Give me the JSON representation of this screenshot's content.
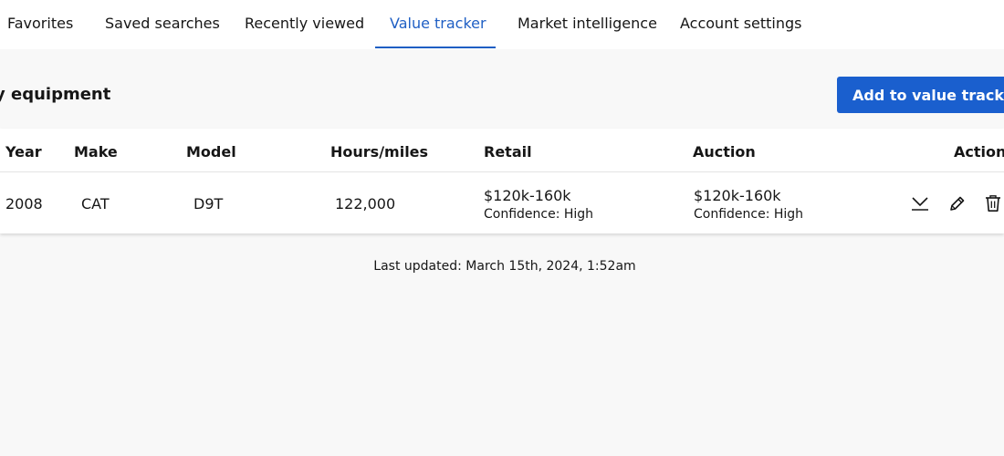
{
  "tabs": [
    {
      "label": "Favorites",
      "active": false
    },
    {
      "label": "Saved searches",
      "active": false
    },
    {
      "label": "Recently viewed",
      "active": false
    },
    {
      "label": "Value tracker",
      "active": true
    },
    {
      "label": "Market intelligence",
      "active": false
    },
    {
      "label": "Account settings",
      "active": false
    }
  ],
  "section": {
    "title": "y equipment",
    "add_button_label": "Add to value tracker"
  },
  "table": {
    "headers": {
      "year": "Year",
      "make": "Make",
      "model": "Model",
      "hours": "Hours/miles",
      "retail": "Retail",
      "auction": "Auction",
      "actions": "Actions"
    },
    "rows": [
      {
        "year": "2008",
        "make": "CAT",
        "model": "D9T",
        "hours": "122,000",
        "retail_price": "$120k-160k",
        "retail_confidence": "Confidence: High",
        "auction_price": "$120k-160k",
        "auction_confidence": "Confidence: High",
        "actions": [
          "chevron-down-icon",
          "pencil-icon",
          "trash-icon"
        ]
      }
    ]
  },
  "footer": {
    "last_updated": "Last updated: March 15th, 2024, 1:52am"
  },
  "colors": {
    "accent": "#1f5fc4",
    "button_bg": "#1a5fce",
    "page_bg": "#f8f8f8"
  }
}
